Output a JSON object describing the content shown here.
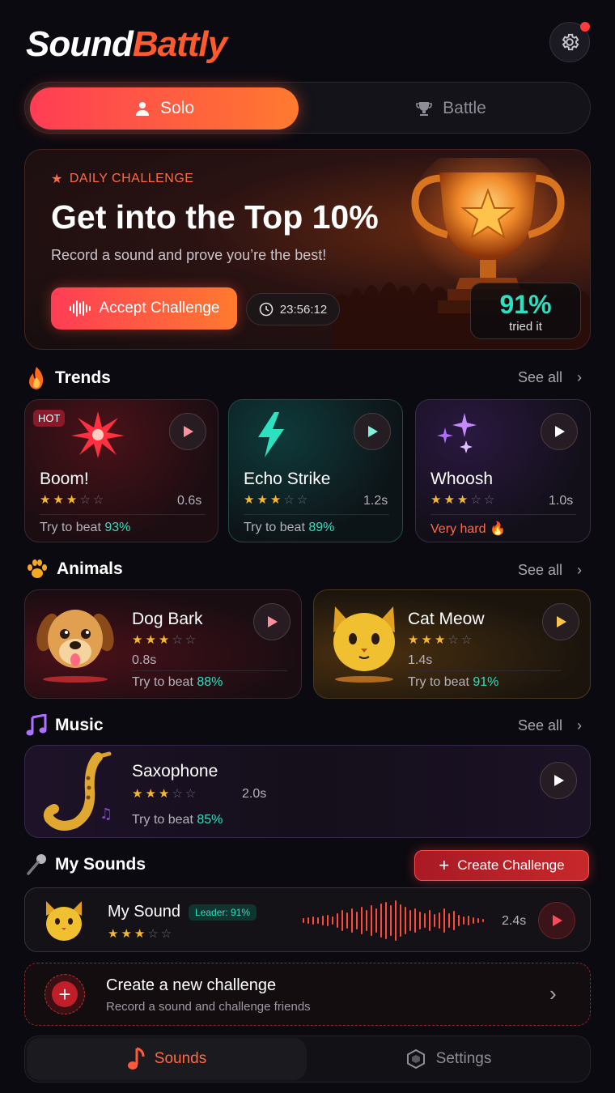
{
  "app": {
    "logo_part1": "Sound",
    "logo_part2": "Battly"
  },
  "mode_tabs": [
    {
      "label": "Solo",
      "active": true
    },
    {
      "label": "Battle",
      "active": false
    }
  ],
  "hero": {
    "tag": "DAILY CHALLENGE",
    "title": "Get into the Top 10%",
    "subtitle": "Record a sound and prove you’re the best!",
    "accept_label": "Accept Challenge",
    "timer": "23:56:12",
    "percent": "91%",
    "percent_label": "tried it"
  },
  "trends": {
    "title": "Trends",
    "see_all": "See all",
    "items": [
      {
        "name": "Boom!",
        "badge": "HOT",
        "rating": 3,
        "duration": "0.6s",
        "beat_label": "Try to beat",
        "beat_value": "93%"
      },
      {
        "name": "Echo Strike",
        "rating": 3,
        "duration": "1.2s",
        "beat_label": "Try to beat",
        "beat_value": "89%"
      },
      {
        "name": "Whoosh",
        "rating": 3,
        "duration": "1.0s",
        "status": "Very hard"
      }
    ]
  },
  "animals": {
    "title": "Animals",
    "see_all": "See all",
    "items": [
      {
        "name": "Dog Bark",
        "rating": 3,
        "duration": "0.8s",
        "beat_label": "Try to beat",
        "beat_value": "88%"
      },
      {
        "name": "Cat Meow",
        "rating": 3,
        "duration": "1.4s",
        "beat_label": "Try to beat",
        "beat_value": "91%"
      }
    ]
  },
  "music": {
    "title": "Music",
    "see_all": "See all",
    "items": [
      {
        "name": "Saxophone",
        "rating": 3,
        "duration": "2.0s",
        "beat_label": "Try to beat",
        "beat_value": "85%"
      }
    ]
  },
  "my_sounds": {
    "title": "My Sounds",
    "create_label": "Create Challenge",
    "item": {
      "name": "My Sound",
      "leader": "Leader: 91%",
      "rating": 3,
      "duration": "2.4s"
    },
    "new_challenge": {
      "title": "Create a new challenge",
      "subtitle": "Record a sound and challenge friends"
    }
  },
  "bottom_nav": [
    {
      "label": "Sounds",
      "active": true
    },
    {
      "label": "Settings",
      "active": false
    }
  ],
  "colors": {
    "accent": "#ff5a2e",
    "teal": "#2de0c0",
    "star": "#f5b731"
  }
}
